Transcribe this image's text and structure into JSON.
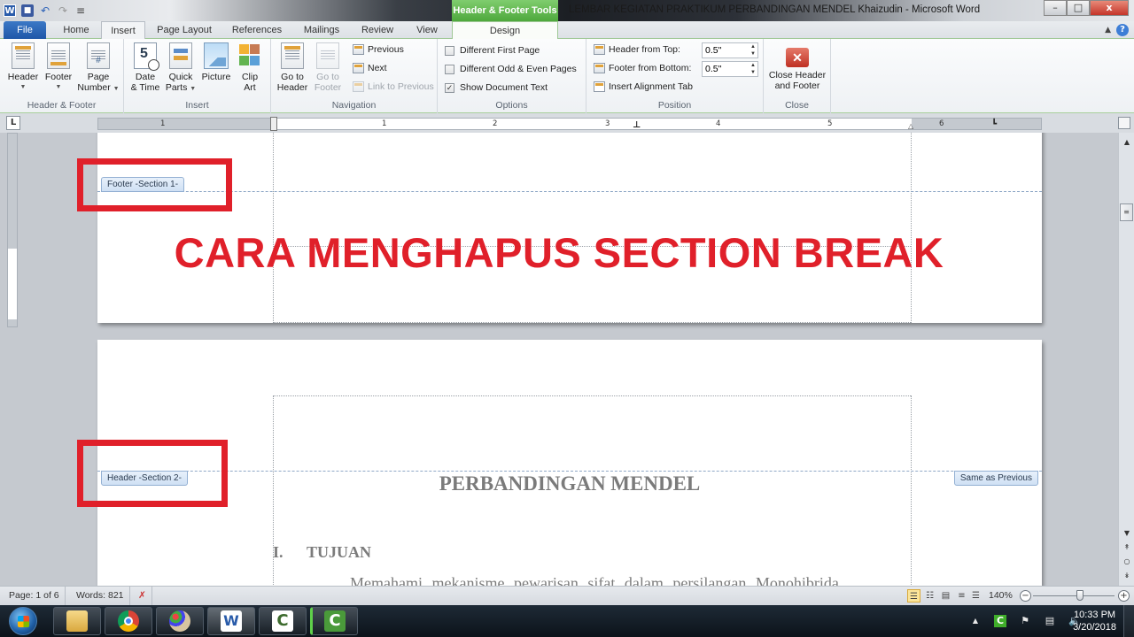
{
  "window": {
    "title": "LEMBAR KEGIATAN PRAKTIKUM PERBANDINGAN MENDEL Khaizudin  -  Microsoft Word",
    "app_icon": "word-icon",
    "controls": {
      "minimize": "–",
      "maximize": "□",
      "close": "x"
    }
  },
  "quick_access": [
    {
      "name": "word-app-icon",
      "glyph": "W"
    },
    {
      "name": "save-icon",
      "glyph": "■"
    },
    {
      "name": "undo-icon",
      "glyph": "↶"
    },
    {
      "name": "redo-icon",
      "glyph": "↷"
    },
    {
      "name": "customize-qat-icon",
      "glyph": "≡"
    }
  ],
  "contextual_group": {
    "label": "Header & Footer Tools",
    "color": "#5cb848"
  },
  "tabs": [
    {
      "label": "File"
    },
    {
      "label": "Home"
    },
    {
      "label": "Insert"
    },
    {
      "label": "Page Layout"
    },
    {
      "label": "References"
    },
    {
      "label": "Mailings"
    },
    {
      "label": "Review"
    },
    {
      "label": "View"
    },
    {
      "label": "Design",
      "active": true
    }
  ],
  "ribbon": {
    "header_footer": {
      "label": "Header & Footer",
      "header": "Header",
      "footer": "Footer",
      "page_number_1": "Page",
      "page_number_2": "Number"
    },
    "insert": {
      "label": "Insert",
      "date_1": "Date",
      "date_2": "& Time",
      "quick_1": "Quick",
      "quick_2": "Parts",
      "picture": "Picture",
      "clip_1": "Clip",
      "clip_2": "Art"
    },
    "navigation": {
      "label": "Navigation",
      "goto_header_1": "Go to",
      "goto_header_2": "Header",
      "goto_footer_1": "Go to",
      "goto_footer_2": "Footer",
      "previous": "Previous",
      "next": "Next",
      "link_previous": "Link to Previous"
    },
    "options": {
      "label": "Options",
      "items": [
        {
          "label": "Different First Page",
          "checked": false
        },
        {
          "label": "Different Odd & Even Pages",
          "checked": false
        },
        {
          "label": "Show Document Text",
          "checked": true
        }
      ]
    },
    "position": {
      "label": "Position",
      "header_from_top": "Header from Top:",
      "header_value": "0.5\"",
      "footer_from_bottom": "Footer from Bottom:",
      "footer_value": "0.5\"",
      "insert_alignment_tab": "Insert Alignment Tab"
    },
    "close": {
      "label": "Close",
      "button_1": "Close Header",
      "button_2": "and Footer"
    }
  },
  "ruler": {
    "tab_selector": "L",
    "numbers": [
      "1",
      "1",
      "2",
      "3",
      "4",
      "5",
      "6"
    ]
  },
  "document": {
    "footer_tag": "Footer -Section 1-",
    "header_tag": "Header -Section 2-",
    "same_as_previous": "Same as Previous",
    "overlay_title": "CARA MENGHAPUS SECTION BREAK",
    "overlay_color": "#e0202a",
    "title": "PERBANDINGAN MENDEL",
    "heading_number": "I.",
    "heading_text": "TUJUAN",
    "paragraph": "Memahami mekanisme pewarisan sifat dalam persilangan Monohibrida"
  },
  "statusbar": {
    "page": "Page: 1 of 6",
    "words": "Words: 821",
    "proofing_icon": "proofing-error-icon",
    "zoom_level": "140%",
    "zoom_fraction": 0.58,
    "views": [
      "print-layout",
      "full-screen-reading",
      "web-layout",
      "outline",
      "draft"
    ],
    "active_view": "print-layout"
  },
  "taskbar": {
    "apps": [
      {
        "name": "windows-explorer",
        "color": "#e8c26a"
      },
      {
        "name": "google-chrome",
        "color": "#db4437"
      },
      {
        "name": "paint",
        "color": "#c7a77a"
      },
      {
        "name": "microsoft-word",
        "color": "#2a5caa",
        "active": true
      },
      {
        "name": "camtasia-recorder",
        "color": "#ffffff"
      },
      {
        "name": "camtasia-studio",
        "color": "#4a9a3a"
      }
    ],
    "tray": {
      "show_hidden": "▲",
      "time": "10:33 PM",
      "date": "3/20/2018"
    }
  }
}
